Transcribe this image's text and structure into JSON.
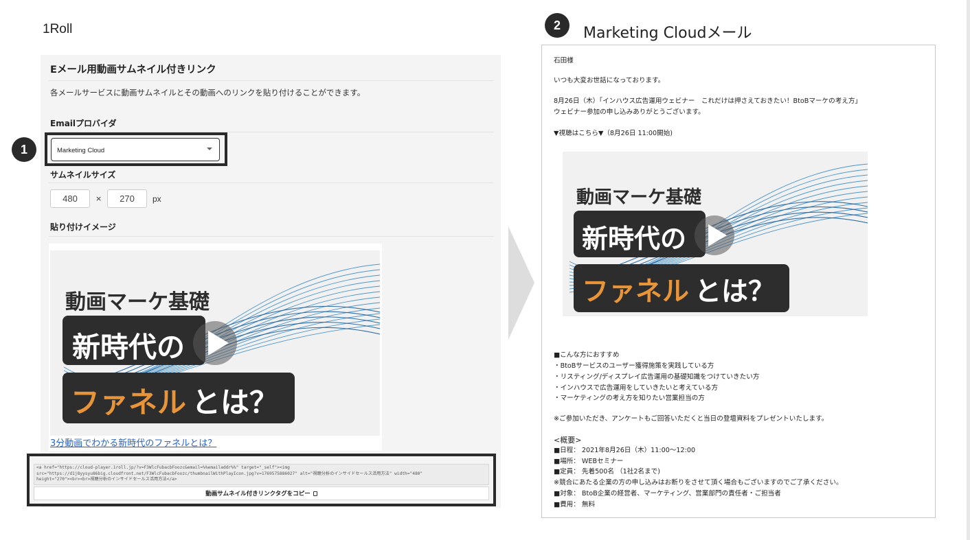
{
  "left": {
    "heading": "1Roll",
    "step_number": "1",
    "panel_title": "Eメール用動画サムネイル付きリンク",
    "description": "各メールサービスに動画サムネイルとその動画へのリンクを貼り付けることができます。",
    "provider_label": "Emailプロバイダ",
    "provider_value": "Marketing Cloud",
    "thumb_size_label": "サムネイルサイズ",
    "width_value": "480",
    "times": "×",
    "height_value": "270",
    "unit": "px",
    "paste_image_label": "貼り付けイメージ",
    "video_link_text": "3分動画でわかる新時代のファネルとは？",
    "code_lines": [
      "<a href=\"https://cloud-player.1roll.jp/?v=F3WlcFubacbFoozc&email=%%emailaddr%%\" target=\"_self\"><img",
      "src=\"https://d1j8yysyu86big.cloudfront.net/F3WlcFubacbFoozc/thumbnailWithPlayIcon.jpg?v=1769575886027\" alt=\"視聴分析のインサイドセールス活用方法\" width=\"480\"",
      "height=\"270\"><br><br>視聴分析のインサイドセールス活用方法</a>"
    ],
    "copy_button_label": "動画サムネイル付きリンクタグをコピー"
  },
  "thumbnail": {
    "line1": "動画マーケ基礎",
    "line2": "新時代の",
    "line3_accent": "ファネル",
    "line3_rest": "とは？"
  },
  "right": {
    "step_number": "2",
    "heading": "Marketing Cloudメール",
    "email_lines": {
      "greeting": "石田様",
      "thanks": "いつも大変お世話になっております。",
      "event_line": "8月26日（木）「インハウス広告運用ウェビナー　これだけは押さえておきたい！BtoBマーケの考え方」",
      "thanks2": "ウェビナー参加の申し込みありがとうございます。",
      "watch": "▼視聴はこちら▼（8月26日 11:00開始)",
      "rec_title": "■こんな方におすすめ",
      "rec1": "・BtoBサービスのユーザー獲得施策を実践している方",
      "rec2": "・リスティング/ディスプレイ広告運用の基礎知識をつけていきたい方",
      "rec3": "・インハウスで広告運用をしていきたいと考えている方",
      "rec4": "・マーケティングの考え方を知りたい営業担当の方",
      "gift": "※ご参加いただき、アンケートもご回答いただくと当日の登壇資料をプレゼントいたします。",
      "overview": "<概要>",
      "date": "■日程： 2021年8月26日（木）11:00〜12:00",
      "place": "■場所： WEBセミナー",
      "capacity": "■定員： 先着500名 （1社2名まで)",
      "note": "※競合にあたる企業の方の申し込みはお断りをさせて頂く場合もございますのでご了承ください。",
      "target": "■対象： BtoB企業の経営者、マーケティング、営業部門の責任者・ご担当者",
      "fee": "■費用： 無料"
    }
  },
  "colors": {
    "accent_orange": "#e8953a",
    "link_blue": "#2a63c9",
    "dark_box": "#2d2d2d",
    "wave_blue": "#2f86c8"
  }
}
